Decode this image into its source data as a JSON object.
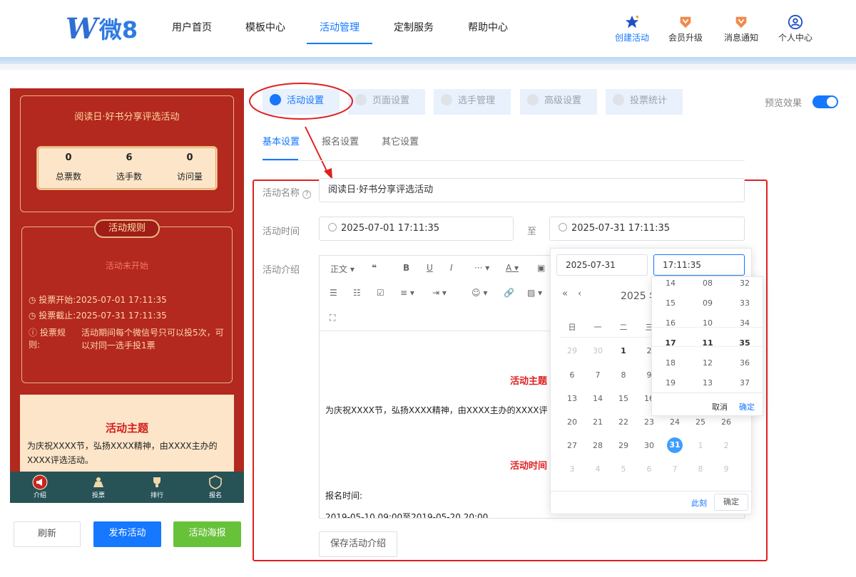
{
  "header": {
    "logo_text": "微8",
    "nav": [
      "用户首页",
      "模板中心",
      "活动管理",
      "定制服务",
      "帮助中心"
    ],
    "actions": [
      {
        "label": "创建活动",
        "icon": "star-icon"
      },
      {
        "label": "会员升级",
        "icon": "vip-badge-icon"
      },
      {
        "label": "消息通知",
        "icon": "bell-badge-icon"
      },
      {
        "label": "个人中心",
        "icon": "user-icon"
      }
    ]
  },
  "preview": {
    "title": "阅读日·好书分享评选活动",
    "stats": [
      {
        "value": "0",
        "label": "总票数"
      },
      {
        "value": "6",
        "label": "选手数"
      },
      {
        "value": "0",
        "label": "访问量"
      }
    ],
    "rules_title": "活动规则",
    "status": "活动未开始",
    "vote_start": "投票开始:",
    "vote_start_val": "2025-07-01 17:11:35",
    "vote_end": "投票截止:",
    "vote_end_val": "2025-07-31 17:11:35",
    "rule_label": "投票规则:",
    "rule_text": "活动期间每个微信号只可以投5次，可以对同一选手投1票",
    "theme_title": "活动主题",
    "theme_text": "为庆祝XXXX节，弘扬XXXX精神，由XXXX主办的XXXX评选活动。",
    "bottom_nav": [
      "介绍",
      "投票",
      "排行",
      "报名"
    ]
  },
  "buttons": {
    "refresh": "刷新",
    "publish": "发布活动",
    "poster": "活动海报",
    "save_intro": "保存活动介绍"
  },
  "tabs": [
    "活动设置",
    "页面设置",
    "选手管理",
    "高级设置",
    "投票统计"
  ],
  "preview_toggle": "预览效果",
  "subtabs": [
    "基本设置",
    "报名设置",
    "其它设置"
  ],
  "form": {
    "name_label": "活动名称",
    "name_value": "阅读日·好书分享评选活动",
    "time_label": "活动时间",
    "start": "2025-07-01 17:11:35",
    "to": "至",
    "end": "2025-07-31 17:11:35",
    "intro_label": "活动介绍"
  },
  "toolbar": {
    "para": "正文",
    "more": "···",
    "align": "≡",
    "indent": "⇥"
  },
  "editor": {
    "theme_heading": "活动主题",
    "theme_text": "为庆祝XXXX节，弘扬XXXX精神，由XXXX主办的XXXX评",
    "time_heading": "活动时间",
    "signup_label": "报名时间:",
    "signup_value": "2019-05-10 09:00至2019-05-20 20:00"
  },
  "datepicker": {
    "date_input": "2025-07-31",
    "time_input": "17:11:35",
    "year_label": "2025 年",
    "weekdays": [
      "日",
      "一",
      "二",
      "三"
    ],
    "rows": [
      [
        "29",
        "30",
        "1",
        "2"
      ],
      [
        "6",
        "7",
        "8",
        "9"
      ],
      [
        "13",
        "14",
        "15",
        "16"
      ],
      [
        "20",
        "21",
        "22",
        "23",
        "24",
        "25",
        "26"
      ],
      [
        "27",
        "28",
        "29",
        "30",
        "31",
        "1",
        "2"
      ],
      [
        "3",
        "4",
        "5",
        "6",
        "7",
        "8",
        "9"
      ]
    ],
    "now": "此刻",
    "confirm": "确定"
  },
  "timepicker": {
    "cols": [
      [
        "14",
        "15",
        "16",
        "17",
        "18",
        "19"
      ],
      [
        "08",
        "09",
        "10",
        "11",
        "12",
        "13"
      ],
      [
        "32",
        "33",
        "34",
        "35",
        "36",
        "37"
      ]
    ],
    "cancel": "取消",
    "confirm": "确定"
  },
  "colors": {
    "accent": "#1677ff",
    "annotation": "#e02020",
    "preview_bg": "#b3281f",
    "poster_green": "#67c23a"
  }
}
